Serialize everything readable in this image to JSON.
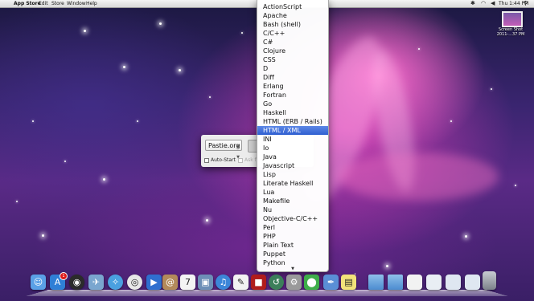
{
  "menubar": {
    "app_name": "App Store",
    "items": [
      "Edit",
      "Store",
      "Window",
      "Help"
    ],
    "clock": "Thu 1:44 PM"
  },
  "desktop_icon": {
    "label_line1": "Screen Shot",
    "label_line2": "2011-...37 PM"
  },
  "window": {
    "service_value": "Pastie.org",
    "auto_start_label": "Auto-Start",
    "ask_label": "Ask f"
  },
  "popup": {
    "selected": "HTML / XML",
    "options": [
      "ActionScript",
      "Apache",
      "Bash (shell)",
      "C/C++",
      "C#",
      "Clojure",
      "CSS",
      "D",
      "Diff",
      "Erlang",
      "Fortran",
      "Go",
      "Haskell",
      "HTML (ERB / Rails)",
      "HTML / XML",
      "INI",
      "Io",
      "Java",
      "Javascript",
      "Lisp",
      "Literate Haskell",
      "Lua",
      "Makefile",
      "Nu",
      "Objective-C/C++",
      "Perl",
      "PHP",
      "Plain Text",
      "Puppet",
      "Python"
    ],
    "scroll_indicator": "▼"
  },
  "dock": {
    "mail_badge": "1",
    "calendar_day": "7",
    "icons": [
      {
        "name": "finder-icon",
        "color": "#5aa0e6"
      },
      {
        "name": "app-store-icon",
        "color": "#2f7fd6"
      },
      {
        "name": "dashboard-icon",
        "color": "#2b2b2b"
      },
      {
        "name": "mail-icon",
        "color": "#7aa6cf"
      },
      {
        "name": "safari-icon",
        "color": "#4aa0e0"
      },
      {
        "name": "chrome-icon",
        "color": "#e7e7e7"
      },
      {
        "name": "facetime-icon",
        "color": "#2f6fcf"
      },
      {
        "name": "address-book-icon",
        "color": "#b38a5a"
      },
      {
        "name": "ical-icon",
        "color": "#f4f4f4"
      },
      {
        "name": "iphoto-icon",
        "color": "#6d8fb7"
      },
      {
        "name": "itunes-icon",
        "color": "#3c86d8"
      },
      {
        "name": "textedit-icon",
        "color": "#f2f2f2"
      },
      {
        "name": "photo-booth-icon",
        "color": "#b01c1c"
      },
      {
        "name": "time-machine-icon",
        "color": "#3c7f5a"
      },
      {
        "name": "system-preferences-icon",
        "color": "#9a9a9a"
      },
      {
        "name": "utility-icon",
        "color": "#3fae4a"
      },
      {
        "name": "xcode-icon",
        "color": "#5a8fd6"
      },
      {
        "name": "stickies-icon",
        "color": "#f2e27a"
      }
    ]
  }
}
